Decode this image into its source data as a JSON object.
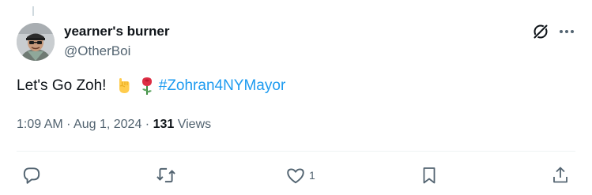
{
  "author": {
    "display_name": "yearner's burner",
    "handle": "@OtherBoi"
  },
  "tweet": {
    "text_before": "Let's Go Zoh! ",
    "emojis": [
      "raised-fist-emoji",
      "rose-emoji"
    ],
    "hashtag": "#Zohran4NYMayor",
    "time": "1:09 AM",
    "separator": "·",
    "date": "Aug 1, 2024",
    "views_count": "131",
    "views_label": "Views"
  },
  "actions": {
    "like_count": "1"
  },
  "icons": [
    "grok-icon",
    "more-icon",
    "reply-icon",
    "retweet-icon",
    "like-icon",
    "bookmark-icon",
    "share-icon"
  ],
  "colors": {
    "text": "#0f1419",
    "secondary": "#536471",
    "link": "#1d9bf0"
  }
}
